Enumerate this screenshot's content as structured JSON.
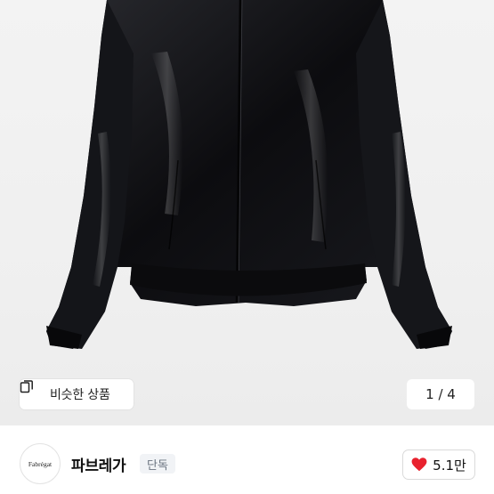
{
  "product_image": {
    "subject": "black glossy zip-up jacket"
  },
  "gallery": {
    "similar_button_label": "비슷한 상품",
    "similar_icon": "similar-products-icon",
    "counter": "1 / 4"
  },
  "shop": {
    "logo_text": "Fabrégat",
    "name": "파브레가",
    "badge": "단독"
  },
  "like": {
    "icon": "heart-icon",
    "count": "5.1만",
    "color": "#e8222e"
  }
}
